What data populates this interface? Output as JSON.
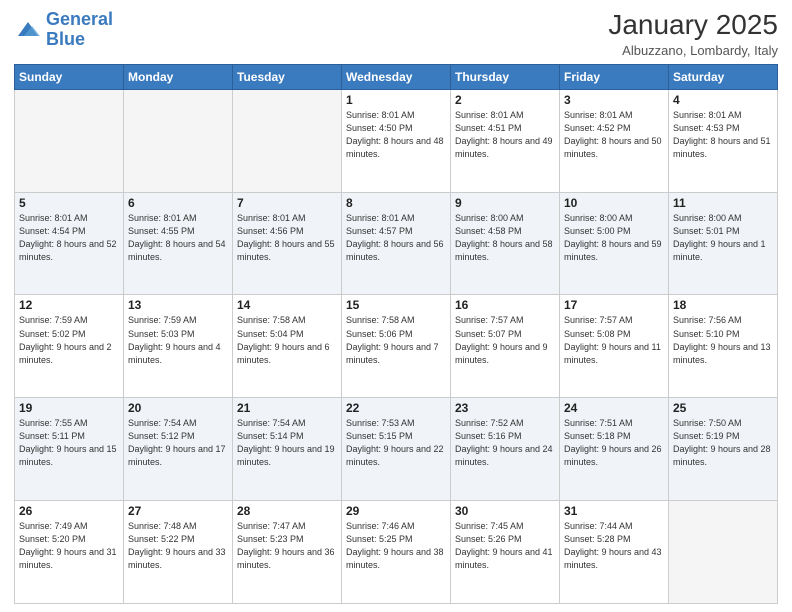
{
  "logo": {
    "line1": "General",
    "line2": "Blue"
  },
  "header": {
    "month": "January 2025",
    "location": "Albuzzano, Lombardy, Italy"
  },
  "weekdays": [
    "Sunday",
    "Monday",
    "Tuesday",
    "Wednesday",
    "Thursday",
    "Friday",
    "Saturday"
  ],
  "weeks": [
    [
      {
        "day": "",
        "sunrise": "",
        "sunset": "",
        "daylight": "",
        "empty": true
      },
      {
        "day": "",
        "sunrise": "",
        "sunset": "",
        "daylight": "",
        "empty": true
      },
      {
        "day": "",
        "sunrise": "",
        "sunset": "",
        "daylight": "",
        "empty": true
      },
      {
        "day": "1",
        "sunrise": "Sunrise: 8:01 AM",
        "sunset": "Sunset: 4:50 PM",
        "daylight": "Daylight: 8 hours and 48 minutes."
      },
      {
        "day": "2",
        "sunrise": "Sunrise: 8:01 AM",
        "sunset": "Sunset: 4:51 PM",
        "daylight": "Daylight: 8 hours and 49 minutes."
      },
      {
        "day": "3",
        "sunrise": "Sunrise: 8:01 AM",
        "sunset": "Sunset: 4:52 PM",
        "daylight": "Daylight: 8 hours and 50 minutes."
      },
      {
        "day": "4",
        "sunrise": "Sunrise: 8:01 AM",
        "sunset": "Sunset: 4:53 PM",
        "daylight": "Daylight: 8 hours and 51 minutes."
      }
    ],
    [
      {
        "day": "5",
        "sunrise": "Sunrise: 8:01 AM",
        "sunset": "Sunset: 4:54 PM",
        "daylight": "Daylight: 8 hours and 52 minutes."
      },
      {
        "day": "6",
        "sunrise": "Sunrise: 8:01 AM",
        "sunset": "Sunset: 4:55 PM",
        "daylight": "Daylight: 8 hours and 54 minutes."
      },
      {
        "day": "7",
        "sunrise": "Sunrise: 8:01 AM",
        "sunset": "Sunset: 4:56 PM",
        "daylight": "Daylight: 8 hours and 55 minutes."
      },
      {
        "day": "8",
        "sunrise": "Sunrise: 8:01 AM",
        "sunset": "Sunset: 4:57 PM",
        "daylight": "Daylight: 8 hours and 56 minutes."
      },
      {
        "day": "9",
        "sunrise": "Sunrise: 8:00 AM",
        "sunset": "Sunset: 4:58 PM",
        "daylight": "Daylight: 8 hours and 58 minutes."
      },
      {
        "day": "10",
        "sunrise": "Sunrise: 8:00 AM",
        "sunset": "Sunset: 5:00 PM",
        "daylight": "Daylight: 8 hours and 59 minutes."
      },
      {
        "day": "11",
        "sunrise": "Sunrise: 8:00 AM",
        "sunset": "Sunset: 5:01 PM",
        "daylight": "Daylight: 9 hours and 1 minute."
      }
    ],
    [
      {
        "day": "12",
        "sunrise": "Sunrise: 7:59 AM",
        "sunset": "Sunset: 5:02 PM",
        "daylight": "Daylight: 9 hours and 2 minutes."
      },
      {
        "day": "13",
        "sunrise": "Sunrise: 7:59 AM",
        "sunset": "Sunset: 5:03 PM",
        "daylight": "Daylight: 9 hours and 4 minutes."
      },
      {
        "day": "14",
        "sunrise": "Sunrise: 7:58 AM",
        "sunset": "Sunset: 5:04 PM",
        "daylight": "Daylight: 9 hours and 6 minutes."
      },
      {
        "day": "15",
        "sunrise": "Sunrise: 7:58 AM",
        "sunset": "Sunset: 5:06 PM",
        "daylight": "Daylight: 9 hours and 7 minutes."
      },
      {
        "day": "16",
        "sunrise": "Sunrise: 7:57 AM",
        "sunset": "Sunset: 5:07 PM",
        "daylight": "Daylight: 9 hours and 9 minutes."
      },
      {
        "day": "17",
        "sunrise": "Sunrise: 7:57 AM",
        "sunset": "Sunset: 5:08 PM",
        "daylight": "Daylight: 9 hours and 11 minutes."
      },
      {
        "day": "18",
        "sunrise": "Sunrise: 7:56 AM",
        "sunset": "Sunset: 5:10 PM",
        "daylight": "Daylight: 9 hours and 13 minutes."
      }
    ],
    [
      {
        "day": "19",
        "sunrise": "Sunrise: 7:55 AM",
        "sunset": "Sunset: 5:11 PM",
        "daylight": "Daylight: 9 hours and 15 minutes."
      },
      {
        "day": "20",
        "sunrise": "Sunrise: 7:54 AM",
        "sunset": "Sunset: 5:12 PM",
        "daylight": "Daylight: 9 hours and 17 minutes."
      },
      {
        "day": "21",
        "sunrise": "Sunrise: 7:54 AM",
        "sunset": "Sunset: 5:14 PM",
        "daylight": "Daylight: 9 hours and 19 minutes."
      },
      {
        "day": "22",
        "sunrise": "Sunrise: 7:53 AM",
        "sunset": "Sunset: 5:15 PM",
        "daylight": "Daylight: 9 hours and 22 minutes."
      },
      {
        "day": "23",
        "sunrise": "Sunrise: 7:52 AM",
        "sunset": "Sunset: 5:16 PM",
        "daylight": "Daylight: 9 hours and 24 minutes."
      },
      {
        "day": "24",
        "sunrise": "Sunrise: 7:51 AM",
        "sunset": "Sunset: 5:18 PM",
        "daylight": "Daylight: 9 hours and 26 minutes."
      },
      {
        "day": "25",
        "sunrise": "Sunrise: 7:50 AM",
        "sunset": "Sunset: 5:19 PM",
        "daylight": "Daylight: 9 hours and 28 minutes."
      }
    ],
    [
      {
        "day": "26",
        "sunrise": "Sunrise: 7:49 AM",
        "sunset": "Sunset: 5:20 PM",
        "daylight": "Daylight: 9 hours and 31 minutes."
      },
      {
        "day": "27",
        "sunrise": "Sunrise: 7:48 AM",
        "sunset": "Sunset: 5:22 PM",
        "daylight": "Daylight: 9 hours and 33 minutes."
      },
      {
        "day": "28",
        "sunrise": "Sunrise: 7:47 AM",
        "sunset": "Sunset: 5:23 PM",
        "daylight": "Daylight: 9 hours and 36 minutes."
      },
      {
        "day": "29",
        "sunrise": "Sunrise: 7:46 AM",
        "sunset": "Sunset: 5:25 PM",
        "daylight": "Daylight: 9 hours and 38 minutes."
      },
      {
        "day": "30",
        "sunrise": "Sunrise: 7:45 AM",
        "sunset": "Sunset: 5:26 PM",
        "daylight": "Daylight: 9 hours and 41 minutes."
      },
      {
        "day": "31",
        "sunrise": "Sunrise: 7:44 AM",
        "sunset": "Sunset: 5:28 PM",
        "daylight": "Daylight: 9 hours and 43 minutes."
      },
      {
        "day": "",
        "sunrise": "",
        "sunset": "",
        "daylight": "",
        "empty": true
      }
    ]
  ]
}
